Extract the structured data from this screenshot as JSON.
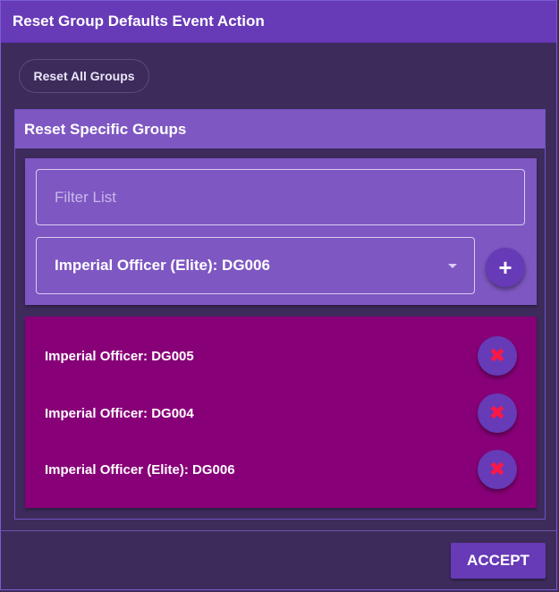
{
  "dialog": {
    "title": "Reset Group Defaults Event Action",
    "accept_label": "ACCEPT"
  },
  "reset_all": {
    "label": "Reset All Groups"
  },
  "specific": {
    "header": "Reset Specific Groups",
    "filter": {
      "placeholder": "Filter List",
      "value": ""
    },
    "select": {
      "selected": "Imperial Officer (Elite): DG006",
      "caret_icon": "caret-down-icon"
    },
    "add_button": {
      "symbol": "+",
      "icon": "plus-icon"
    },
    "groups": [
      {
        "label": "Imperial Officer: DG005",
        "remove_symbol": "✖"
      },
      {
        "label": "Imperial Officer: DG004",
        "remove_symbol": "✖"
      },
      {
        "label": "Imperial Officer (Elite): DG006",
        "remove_symbol": "✖"
      }
    ]
  },
  "colors": {
    "accent": "#673ab7",
    "panel": "#7e57c2",
    "list_background": "#880078",
    "remove_x": "#ff1744",
    "dialog_background": "#3d2b5c"
  }
}
